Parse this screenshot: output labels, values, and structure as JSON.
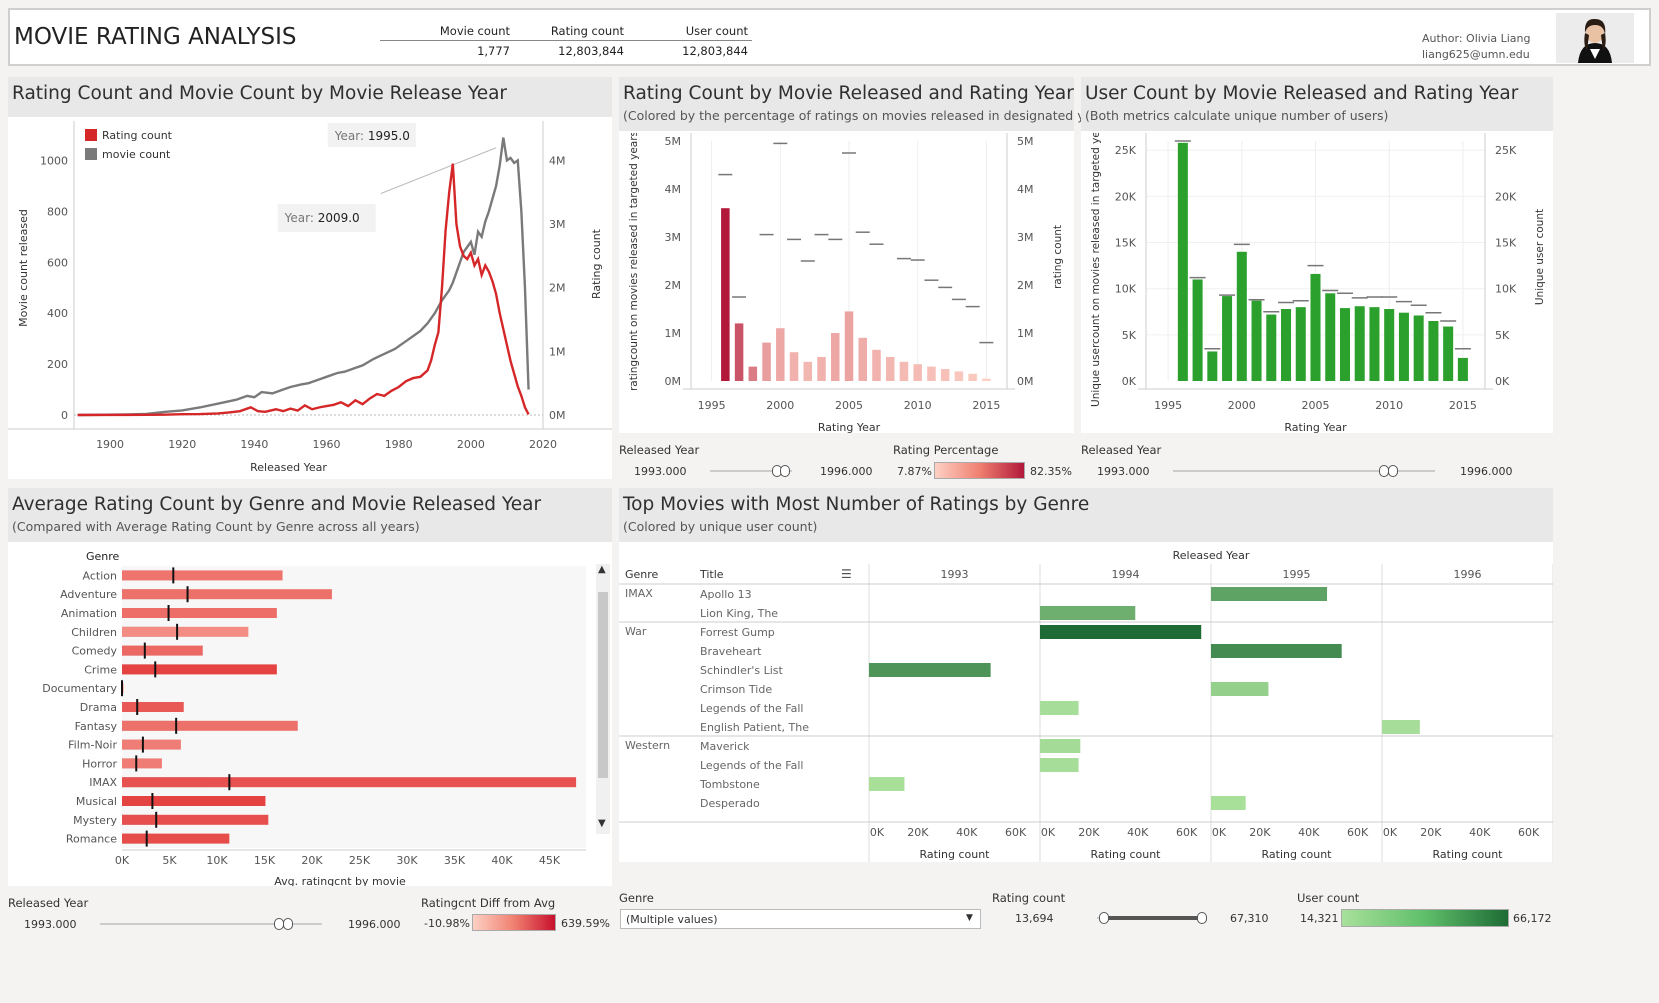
{
  "header": {
    "title": "MOVIE RATING ANALYSIS",
    "kpi_headers": [
      "Movie count",
      "Rating count",
      "User count"
    ],
    "kpi_values": [
      "1,777",
      "12,803,844",
      "12,803,844"
    ],
    "author_label": "Author:",
    "author_name": "Olivia Liang",
    "email": "liang625@umn.edu"
  },
  "panel1": {
    "title": "Rating Count and Movie Count by Movie Release Year",
    "tooltip1_label": "Year:",
    "tooltip1_value": "1995.0",
    "tooltip2_label": "Year:",
    "tooltip2_value": "2009.0"
  },
  "panel2": {
    "title": "Rating Count by Movie Released and Rating Year",
    "subtitle": "(Colored by the percentage of ratings on movies released in designated year)"
  },
  "panel3": {
    "title": "User Count by Movie Released and Rating Year",
    "subtitle": "(Both metrics calculate unique number of users)"
  },
  "panel4": {
    "title": "Average Rating Count by Genre and Movie Released Year",
    "subtitle": "(Compared with Average Rating Count by Genre across all years)"
  },
  "panel5": {
    "title": "Top Movies with Most Number of Ratings by Genre",
    "subtitle": "(Colored by unique user count)"
  },
  "filters": {
    "released_year_label": "Released Year",
    "released_year_min": "1993.000",
    "released_year_max": "1996.000",
    "released_year_low_frac": 0.98,
    "released_year_high_frac": 1.0,
    "rating_pct_label": "Rating Percentage",
    "rating_pct_min": "7.87%",
    "rating_pct_max": "82.35%",
    "diff_label": "Ratingcnt Diff from Avg",
    "diff_min": "-10.98%",
    "diff_max": "639.59%",
    "genre_label": "Genre",
    "genre_value": "(Multiple values)",
    "rating_count_label": "Rating count",
    "rating_count_min": "13,694",
    "rating_count_max": "67,310",
    "user_count_label": "User count",
    "user_count_min": "14,321",
    "user_count_max": "66,172"
  },
  "colors": {
    "red": "#d62728",
    "gray": "#7a7a7a",
    "green_dark": "#1e6b35",
    "green_light": "#a8e09a",
    "green_bar": "#2ca02c",
    "rating_low": "#fdd0c4",
    "rating_high": "#b1183a"
  },
  "chart_data": [
    {
      "type": "line",
      "title": "Rating Count and Movie Count by Movie Release Year",
      "xlabel": "Released Year",
      "ylabel": "Movie count released",
      "y2label": "Rating count",
      "xlim": [
        1890,
        2020
      ],
      "ylim": [
        0,
        1100
      ],
      "y2lim": [
        0,
        4400000
      ],
      "x_ticks": [
        "1900",
        "1920",
        "1940",
        "1960",
        "1980",
        "2000",
        "2020"
      ],
      "y_ticks": [
        "0",
        "200",
        "400",
        "600",
        "800",
        "1000"
      ],
      "y2_ticks": [
        "0M",
        "1M",
        "2M",
        "3M",
        "4M"
      ],
      "legend": "top-left",
      "series": [
        {
          "name": "Rating count",
          "axis": "right",
          "points": [
            [
              1891,
              0
            ],
            [
              1900,
              1000
            ],
            [
              1910,
              3000
            ],
            [
              1915,
              5000
            ],
            [
              1920,
              12000
            ],
            [
              1925,
              15000
            ],
            [
              1930,
              25000
            ],
            [
              1933,
              40000
            ],
            [
              1936,
              60000
            ],
            [
              1939,
              120000
            ],
            [
              1941,
              60000
            ],
            [
              1943,
              50000
            ],
            [
              1946,
              90000
            ],
            [
              1948,
              60000
            ],
            [
              1950,
              100000
            ],
            [
              1952,
              70000
            ],
            [
              1954,
              150000
            ],
            [
              1956,
              90000
            ],
            [
              1958,
              120000
            ],
            [
              1960,
              140000
            ],
            [
              1962,
              160000
            ],
            [
              1964,
              200000
            ],
            [
              1966,
              140000
            ],
            [
              1968,
              230000
            ],
            [
              1970,
              170000
            ],
            [
              1972,
              260000
            ],
            [
              1974,
              330000
            ],
            [
              1976,
              300000
            ],
            [
              1978,
              380000
            ],
            [
              1980,
              440000
            ],
            [
              1982,
              530000
            ],
            [
              1984,
              580000
            ],
            [
              1986,
              600000
            ],
            [
              1988,
              700000
            ],
            [
              1989,
              860000
            ],
            [
              1990,
              1100000
            ],
            [
              1991,
              1300000
            ],
            [
              1992,
              2000000
            ],
            [
              1993,
              2900000
            ],
            [
              1994,
              3500000
            ],
            [
              1995,
              3950000
            ],
            [
              1996,
              3000000
            ],
            [
              1997,
              2650000
            ],
            [
              1998,
              2500000
            ],
            [
              1999,
              2450000
            ],
            [
              2000,
              2550000
            ],
            [
              2001,
              2350000
            ],
            [
              2002,
              2450000
            ],
            [
              2003,
              2200000
            ],
            [
              2004,
              2350000
            ],
            [
              2005,
              2250000
            ],
            [
              2006,
              2100000
            ],
            [
              2007,
              1900000
            ],
            [
              2008,
              1600000
            ],
            [
              2009,
              1350000
            ],
            [
              2010,
              1100000
            ],
            [
              2011,
              850000
            ],
            [
              2012,
              650000
            ],
            [
              2013,
              450000
            ],
            [
              2014,
              300000
            ],
            [
              2015,
              120000
            ],
            [
              2016,
              10000
            ]
          ]
        },
        {
          "name": "movie count",
          "axis": "left",
          "points": [
            [
              1891,
              0
            ],
            [
              1905,
              2
            ],
            [
              1910,
              4
            ],
            [
              1915,
              12
            ],
            [
              1920,
              18
            ],
            [
              1925,
              30
            ],
            [
              1930,
              45
            ],
            [
              1935,
              60
            ],
            [
              1938,
              75
            ],
            [
              1940,
              70
            ],
            [
              1942,
              90
            ],
            [
              1945,
              85
            ],
            [
              1948,
              100
            ],
            [
              1950,
              110
            ],
            [
              1953,
              120
            ],
            [
              1955,
              125
            ],
            [
              1958,
              140
            ],
            [
              1960,
              150
            ],
            [
              1963,
              165
            ],
            [
              1965,
              170
            ],
            [
              1968,
              185
            ],
            [
              1970,
              195
            ],
            [
              1973,
              220
            ],
            [
              1976,
              240
            ],
            [
              1979,
              260
            ],
            [
              1982,
              290
            ],
            [
              1984,
              310
            ],
            [
              1986,
              330
            ],
            [
              1988,
              360
            ],
            [
              1990,
              400
            ],
            [
              1992,
              450
            ],
            [
              1994,
              490
            ],
            [
              1995,
              520
            ],
            [
              1996,
              560
            ],
            [
              1997,
              600
            ],
            [
              1998,
              640
            ],
            [
              1999,
              660
            ],
            [
              2000,
              680
            ],
            [
              2001,
              630
            ],
            [
              2002,
              720
            ],
            [
              2003,
              700
            ],
            [
              2004,
              760
            ],
            [
              2005,
              800
            ],
            [
              2006,
              850
            ],
            [
              2007,
              900
            ],
            [
              2008,
              980
            ],
            [
              2009,
              1090
            ],
            [
              2010,
              1000
            ],
            [
              2011,
              1010
            ],
            [
              2012,
              990
            ],
            [
              2013,
              1000
            ],
            [
              2014,
              800
            ],
            [
              2015,
              500
            ],
            [
              2016,
              100
            ]
          ]
        }
      ]
    },
    {
      "type": "bar",
      "title": "Rating Count by Movie Released and Rating Year",
      "xlabel": "Rating Year",
      "ylabel": "ratingcount on movies released in targeted years",
      "y2label": "rating count",
      "xlim": [
        1993.5,
        2016.5
      ],
      "ylim": [
        0,
        5000000
      ],
      "x_ticks": [
        "1995",
        "2000",
        "2005",
        "2010",
        "2015"
      ],
      "y_ticks": [
        "0M",
        "1M",
        "2M",
        "3M",
        "4M",
        "5M"
      ],
      "years": [
        1996,
        1997,
        1998,
        1999,
        2000,
        2001,
        2002,
        2003,
        2004,
        2005,
        2006,
        2007,
        2008,
        2009,
        2010,
        2011,
        2012,
        2013,
        2014,
        2015
      ],
      "bar_values": [
        3600000,
        1200000,
        300000,
        800000,
        1100000,
        600000,
        400000,
        500000,
        1000000,
        1450000,
        900000,
        650000,
        500000,
        400000,
        350000,
        300000,
        250000,
        200000,
        150000,
        50000
      ],
      "bar_pct": [
        0.82,
        0.58,
        0.42,
        0.28,
        0.24,
        0.2,
        0.18,
        0.2,
        0.24,
        0.26,
        0.22,
        0.2,
        0.18,
        0.17,
        0.16,
        0.15,
        0.14,
        0.12,
        0.11,
        0.08
      ],
      "ref_values": [
        4300000,
        1750000,
        4950000,
        3050000,
        2950000,
        2500000,
        3050000,
        4750000,
        3100000,
        2950000,
        2850000,
        2550000,
        2520000,
        2100000,
        1950000,
        1700000,
        1550000,
        800000
      ],
      "ref_years": [
        1996,
        1997,
        2000,
        1999,
        2001,
        2002,
        2003,
        2005,
        2006,
        2004,
        2007,
        2009,
        2010,
        2011,
        2012,
        2013,
        2014,
        2015
      ]
    },
    {
      "type": "bar",
      "title": "User Count by Movie Released and Rating Year",
      "xlabel": "Rating Year",
      "ylabel": "Unique usercount on movies released in targeted years",
      "y2label": "Unique user count",
      "xlim": [
        1993.5,
        2016.5
      ],
      "ylim": [
        0,
        26000
      ],
      "x_ticks": [
        "1995",
        "2000",
        "2005",
        "2010",
        "2015"
      ],
      "y_ticks": [
        "0K",
        "5K",
        "10K",
        "15K",
        "20K",
        "25K"
      ],
      "years": [
        1996,
        1997,
        1998,
        1999,
        2000,
        2001,
        2002,
        2003,
        2004,
        2005,
        2006,
        2007,
        2008,
        2009,
        2010,
        2011,
        2012,
        2013,
        2014,
        2015
      ],
      "bar_values": [
        25800,
        11000,
        3200,
        9200,
        14000,
        8700,
        7200,
        7800,
        8000,
        11600,
        9500,
        7900,
        8100,
        8000,
        7800,
        7400,
        7100,
        6500,
        5900,
        2500
      ],
      "ref_values": [
        26000,
        11200,
        3500,
        9300,
        14800,
        8800,
        7500,
        8500,
        8700,
        12500,
        9800,
        9500,
        9000,
        9100,
        9100,
        8600,
        8200,
        7400,
        6500,
        3500
      ]
    },
    {
      "type": "bar",
      "title": "Average Rating Count by Genre and Movie Released Year",
      "xlabel": "Avg. ratingcnt by movie",
      "ylabel": "Genre",
      "xlim": [
        0,
        48000
      ],
      "x_ticks": [
        "0K",
        "5K",
        "10K",
        "15K",
        "20K",
        "25K",
        "30K",
        "35K",
        "40K",
        "45K"
      ],
      "categories": [
        "Action",
        "Adventure",
        "Animation",
        "Children",
        "Comedy",
        "Crime",
        "Documentary",
        "Drama",
        "Fantasy",
        "Film-Noir",
        "Horror",
        "IMAX",
        "Musical",
        "Mystery",
        "Romance"
      ],
      "values": [
        16900,
        22100,
        16300,
        13300,
        8500,
        16300,
        200,
        6500,
        18500,
        6200,
        4200,
        47800,
        15100,
        15400,
        11300
      ],
      "avg_values": [
        5400,
        6900,
        4900,
        5800,
        2400,
        3500,
        0,
        1600,
        5700,
        2200,
        1500,
        11300,
        3200,
        3600,
        2600
      ],
      "diff_pct": [
        2.1,
        2.2,
        2.3,
        1.3,
        2.5,
        3.7,
        -0.1,
        3.0,
        2.2,
        1.8,
        1.8,
        3.2,
        3.7,
        3.3,
        3.4
      ],
      "background_values": [
        4400,
        5300,
        5000,
        4300,
        2600,
        2300,
        100,
        3000,
        4800,
        1300,
        1500,
        9100,
        3200,
        1600,
        2000
      ]
    },
    {
      "type": "bar",
      "title": "Top Movies with Most Number of Ratings by Genre",
      "xlabel": "Rating count",
      "columns_label": "Released Year",
      "years": [
        "1993",
        "1994",
        "1995",
        "1996"
      ],
      "x_ticks": [
        "0K",
        "20K",
        "40K",
        "60K"
      ],
      "xlim": [
        0,
        70000
      ],
      "rows": [
        {
          "genre": "IMAX",
          "title": "Apollo 13",
          "year": "1995",
          "rating": 47500,
          "users": 42000
        },
        {
          "genre": "",
          "title": "Lion King, The",
          "year": "1994",
          "rating": 39000,
          "users": 36000
        },
        {
          "genre": "War",
          "title": "Forrest Gump",
          "year": "1994",
          "rating": 66000,
          "users": 66172
        },
        {
          "genre": "",
          "title": "Braveheart",
          "year": "1995",
          "rating": 53500,
          "users": 52000
        },
        {
          "genre": "",
          "title": "Schindler's List",
          "year": "1993",
          "rating": 49800,
          "users": 48000
        },
        {
          "genre": "",
          "title": "Crimson Tide",
          "year": "1995",
          "rating": 23500,
          "users": 22000
        },
        {
          "genre": "",
          "title": "Legends of the Fall",
          "year": "1994",
          "rating": 15800,
          "users": 15000
        },
        {
          "genre": "",
          "title": "English Patient, The",
          "year": "1996",
          "rating": 15500,
          "users": 15000
        },
        {
          "genre": "Western",
          "title": "Maverick",
          "year": "1994",
          "rating": 16500,
          "users": 16000
        },
        {
          "genre": "",
          "title": "Legends of the Fall",
          "year": "1994",
          "rating": 15800,
          "users": 15000
        },
        {
          "genre": "",
          "title": "Tombstone",
          "year": "1993",
          "rating": 14500,
          "users": 14321
        },
        {
          "genre": "",
          "title": "Desperado",
          "year": "1995",
          "rating": 14200,
          "users": 14321
        }
      ]
    }
  ]
}
